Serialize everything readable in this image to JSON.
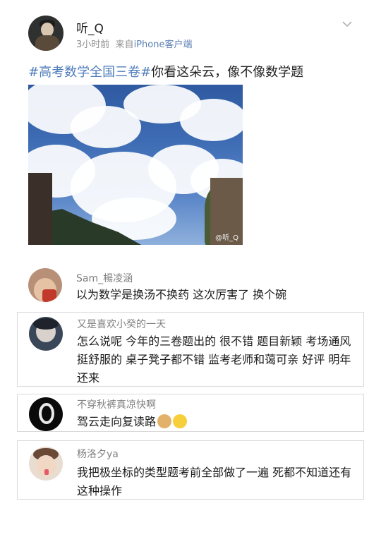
{
  "post": {
    "username": "听_Q",
    "time": "3小时前",
    "source_prefix": "来自",
    "source": "iPhone客户端",
    "hashtag": "#高考数学全国三卷#",
    "text": "你看这朵云，像不像数学题",
    "image_watermark": "@听_Q",
    "avatar_icon": "user-avatar",
    "menu_icon": "chevron-down-icon"
  },
  "comments": [
    {
      "name": "Sam_楊凌涵",
      "text": "以为数学是换汤不换药 这次厉害了 换个碗"
    },
    {
      "name": "又是喜欢小癸的一天",
      "text": "怎么说呢 今年的三卷题出的 很不错  题目新颖 考场通风挺舒服的 桌子凳子都不错 监考老师和蔼可亲 好评 明年还来"
    },
    {
      "name": "不穿秋裤真凉快啊",
      "text": "驾云走向复读路",
      "emojis": [
        "doge-emoji",
        "smile-emoji"
      ]
    },
    {
      "name": "杨洛夕ya",
      "text": "我把极坐标的类型题考前全部做了一遍   死都不知道还有这种操作"
    }
  ],
  "colors": {
    "link": "#4f7dbb",
    "meta": "#8f8f8f",
    "border": "#dadada"
  }
}
